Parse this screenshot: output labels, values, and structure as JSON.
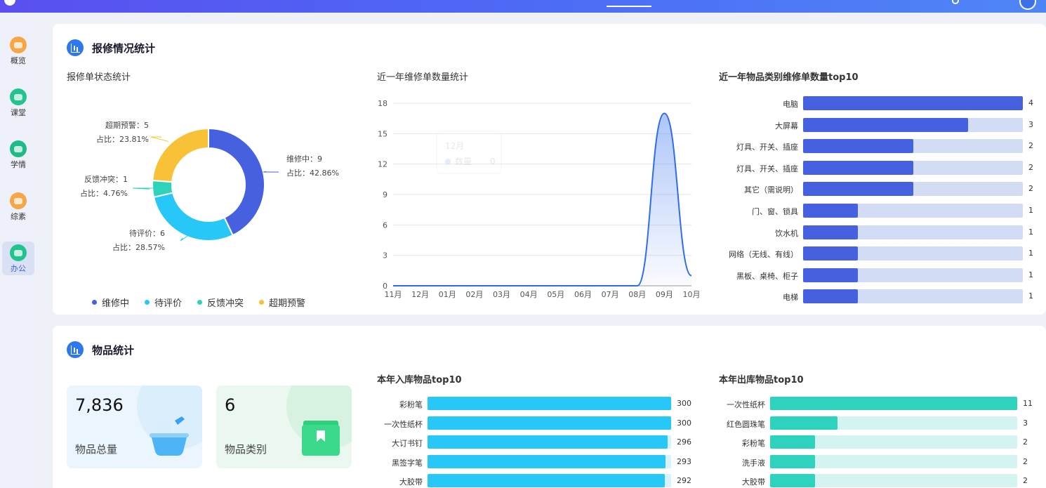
{
  "sidebar": {
    "items": [
      {
        "label": "概览",
        "color": "#f7a646"
      },
      {
        "label": "课堂",
        "color": "#22c38f"
      },
      {
        "label": "学情",
        "color": "#1fb98a"
      },
      {
        "label": "综素",
        "color": "#f7a646"
      },
      {
        "label": "办公",
        "color": "#22c38f",
        "active": true
      }
    ]
  },
  "repair": {
    "title": "报修情况统计",
    "status_title": "报修单状态统计",
    "monthly_title": "近一年维修单数量统计",
    "category_title": "近一年物品类别维修单数量top10"
  },
  "goods": {
    "title": "物品统计",
    "total_value": "7,836",
    "total_label": "物品总量",
    "types_value": "6",
    "types_label": "物品类别",
    "in_title": "本年入库物品top10",
    "out_title": "本年出库物品top10"
  },
  "tooltip": {
    "month": "12月",
    "series": "数量",
    "value": "0"
  },
  "chart_data": [
    {
      "type": "pie",
      "title": "报修单状态统计",
      "slices": [
        {
          "name": "维修中",
          "value": 9,
          "label": "维修中：9",
          "pct": "占比：42.86%",
          "color": "#4561e0"
        },
        {
          "name": "待评价",
          "value": 6,
          "label": "待评价：6",
          "pct": "占比：28.57%",
          "color": "#27c8f8"
        },
        {
          "name": "反馈冲突",
          "value": 1,
          "label": "反馈冲突：1",
          "pct": "占比：4.76%",
          "color": "#2fd3bb"
        },
        {
          "name": "超期预警",
          "value": 5,
          "label": "超期预警：5",
          "pct": "占比：23.81%",
          "color": "#f7c238"
        }
      ],
      "legend_placement": "bottom"
    },
    {
      "type": "area",
      "title": "近一年维修单数量统计",
      "x": [
        "11月",
        "12月",
        "01月",
        "02月",
        "03月",
        "04月",
        "05月",
        "06月",
        "07月",
        "08月",
        "09月",
        "10月"
      ],
      "series": [
        {
          "values": [
            0,
            0,
            0,
            0,
            0,
            0,
            0,
            0,
            0,
            0,
            17,
            1
          ]
        }
      ],
      "ylim": [
        0,
        18
      ],
      "yticks": [
        0,
        3,
        6,
        9,
        12,
        15,
        18
      ],
      "grid": true
    },
    {
      "type": "bar",
      "orientation": "horizontal",
      "title": "近一年物品类别维修单数量top10",
      "categories": [
        "电脑",
        "大屏幕",
        "灯具、开关、插座",
        "灯具、开关、插座",
        "其它（需说明）",
        "门、窗、锁具",
        "饮水机",
        "网络（无线、有线）",
        "黑板、桌椅、柜子",
        "电梯"
      ],
      "values": [
        4,
        3,
        2,
        2,
        2,
        1,
        1,
        1,
        1,
        1
      ],
      "max": 4
    },
    {
      "type": "bar",
      "orientation": "horizontal",
      "title": "本年入库物品top10",
      "categories": [
        "彩粉笔",
        "一次性纸杯",
        "大订书钉",
        "黑签字笔",
        "大胶带"
      ],
      "values": [
        300,
        300,
        296,
        293,
        292
      ],
      "max": 300
    },
    {
      "type": "bar",
      "orientation": "horizontal",
      "title": "本年出库物品top10",
      "categories": [
        "一次性纸杯",
        "红色圆珠笔",
        "彩粉笔",
        "洗手液",
        "大胶带"
      ],
      "values": [
        11,
        3,
        2,
        2,
        2
      ],
      "max": 11
    }
  ]
}
